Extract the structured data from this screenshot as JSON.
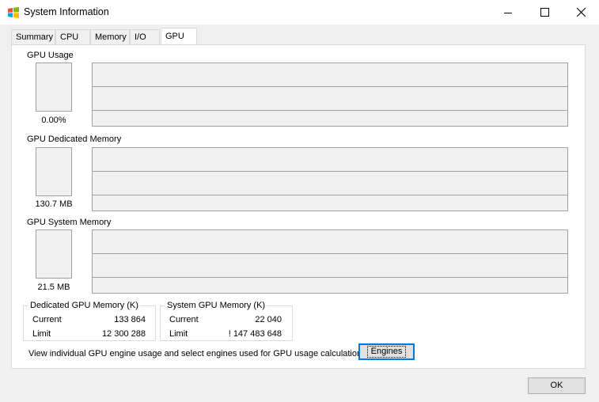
{
  "window": {
    "title": "System Information",
    "icon": "windows-flag-icon",
    "controls": [
      "minimize-icon",
      "maximize-icon",
      "close-icon"
    ]
  },
  "tabs": [
    {
      "label": "Summary",
      "active": false
    },
    {
      "label": "CPU",
      "active": false
    },
    {
      "label": "Memory",
      "active": false
    },
    {
      "label": "I/O",
      "active": false
    },
    {
      "label": "GPU",
      "active": true
    }
  ],
  "sections": [
    {
      "label": "GPU Usage",
      "value": "0.00%"
    },
    {
      "label": "GPU Dedicated Memory",
      "value": "130.7 MB"
    },
    {
      "label": "GPU System Memory",
      "value": "21.5 MB"
    }
  ],
  "dedicated_group": {
    "title": "Dedicated GPU Memory (K)",
    "rows": [
      {
        "label": "Current",
        "value": "133 864"
      },
      {
        "label": "Limit",
        "value": "12 300 288"
      }
    ]
  },
  "system_group": {
    "title": "System GPU Memory (K)",
    "rows": [
      {
        "label": "Current",
        "value": "22 040"
      },
      {
        "label": "Limit",
        "value": "! 147 483 648"
      }
    ]
  },
  "engines_note": "View individual GPU engine usage and select engines used for GPU usage calculations:",
  "engines_button": "Engines",
  "ok_button": "OK",
  "colors": {
    "accent_focus": "#0078d7",
    "graph_bg": "#f0f0f0",
    "border": "#a0a0a0"
  }
}
